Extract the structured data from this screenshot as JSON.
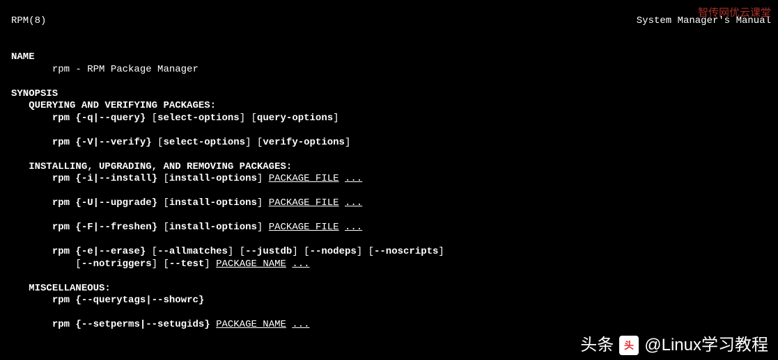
{
  "header": {
    "left": "RPM(8)",
    "right": "System Manager's Manual"
  },
  "sections": {
    "name_heading": "NAME",
    "name_line": "rpm - RPM Package Manager",
    "synopsis_heading": "SYNOPSIS",
    "qv_heading": "QUERYING AND VERIFYING PACKAGES:",
    "query_line": {
      "cmd": "rpm",
      "opt": "{-q|--query}",
      "so": "[select-options]",
      "qo": "[query-options]"
    },
    "verify_line": {
      "cmd": "rpm",
      "opt": "{-V|--verify}",
      "so": "[select-options]",
      "vo": "[verify-options]"
    },
    "iur_heading": "INSTALLING, UPGRADING, AND REMOVING PACKAGES:",
    "install_line": {
      "cmd": "rpm",
      "opt": "{-i|--install}",
      "io": "[install-options]",
      "pf": "PACKAGE_FILE",
      "ell": "..."
    },
    "upgrade_line": {
      "cmd": "rpm",
      "opt": "{-U|--upgrade}",
      "io": "[install-options]",
      "pf": "PACKAGE_FILE",
      "ell": "..."
    },
    "freshen_line": {
      "cmd": "rpm",
      "opt": "{-F|--freshen}",
      "io": "[install-options]",
      "pf": "PACKAGE_FILE",
      "ell": "..."
    },
    "erase_line1": {
      "cmd": "rpm",
      "opt": "{-e|--erase}",
      "o1": "[--allmatches]",
      "o2": "[--justdb]",
      "o3": "[--nodeps]",
      "o4": "[--noscripts]"
    },
    "erase_line2": {
      "o5": "[--notriggers]",
      "o6": "[--test]",
      "pn": "PACKAGE_NAME",
      "ell": "..."
    },
    "misc_heading": "MISCELLANEOUS:",
    "misc_line1": {
      "cmd": "rpm",
      "opt": "{--querytags|--showrc}"
    },
    "misc_line2": {
      "cmd": "rpm",
      "opt": "{--setperms|--setugids}",
      "pn": "PACKAGE_NAME",
      "ell": "..."
    }
  },
  "watermarks": {
    "top_right": "智传网优云课堂",
    "bottom_prefix": "头条",
    "bottom_handle": "@Linux学习教程"
  }
}
